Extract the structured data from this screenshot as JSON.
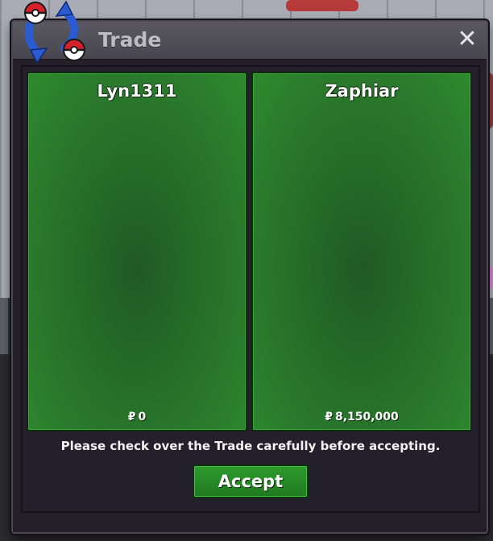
{
  "window": {
    "title": "Trade",
    "close_symbol": "✕"
  },
  "players": [
    {
      "name": "Lyn1311",
      "currency_symbol": "₽",
      "money": "0"
    },
    {
      "name": "Zaphiar",
      "currency_symbol": "₽",
      "money": "8,150,000"
    }
  ],
  "notice": "Please check over the Trade carefully before accepting.",
  "accept_label": "Accept",
  "colors": {
    "panel_green": "#2a7a2c",
    "button_green": "#2e9a2c",
    "window_dark": "#232029",
    "titlebar": "#55535b",
    "logo_blue": "#2a5bd3",
    "pokeball_red": "#d8202a"
  },
  "icons": {
    "trade_logo": "trade-arrows-pokeball-icon",
    "close": "close-icon",
    "currency": "pokedollar-icon"
  }
}
